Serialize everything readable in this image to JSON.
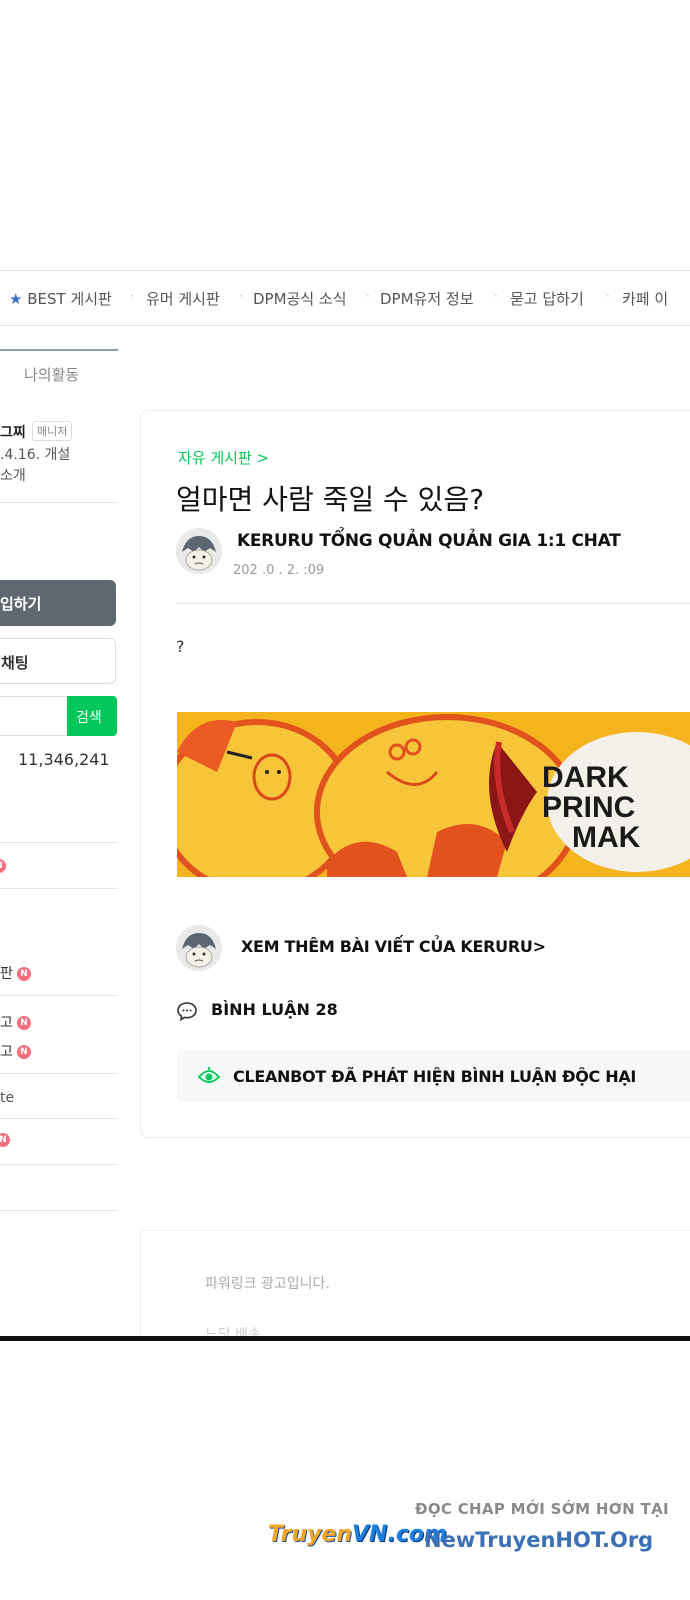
{
  "nav": {
    "items": [
      "BEST 게시판",
      "유머 게시판",
      "DPM공식 소식",
      "DPM유저 정보",
      "묻고 답하기",
      "카페 이"
    ]
  },
  "sidebar": {
    "tab_label": "나의활동",
    "manager_name": "그찌",
    "manager_badge": "매니저",
    "founded": ".4.16. 개설",
    "intro": "소개",
    "join_button": "입하기",
    "chat_button": "채팅",
    "search_button": "검색",
    "member_count": "11,346,241",
    "rows": [
      "판",
      "고",
      "고",
      "te"
    ]
  },
  "post": {
    "breadcrumb": "자유 게시판 >",
    "title": "얼마면 사람 죽일 수 있음?",
    "author": "KERURU TỔNG QUẢN QUẢN GIA 1:1 CHAT",
    "date": "202 .0 . 2.     :09",
    "body": "?",
    "banner_text_line1": "DARK",
    "banner_text_line2": "PRINC",
    "banner_text_line3": "MAK",
    "more_posts": "XEM THÊM BÀI VIẾT CỦA KERURU>",
    "comments": "BÌNH LUẬN 28",
    "cleanbot": "CLEANBOT ĐÃ PHÁT HIỆN BÌNH LUẬN ĐỘC HẠI"
  },
  "ad": {
    "label": "파워링크 광고입니다.",
    "partial": "느닷 배송"
  },
  "watermark": {
    "line1": "ĐỌC CHAP MỚI SỚM HƠN TẠI",
    "logo": "TruyenVN.com",
    "line2": "NewTruyenHOT.Org"
  },
  "colors": {
    "accent_green": "#03c75a",
    "badge_red": "#f56e7e",
    "banner_yellow": "#f4b41e"
  }
}
